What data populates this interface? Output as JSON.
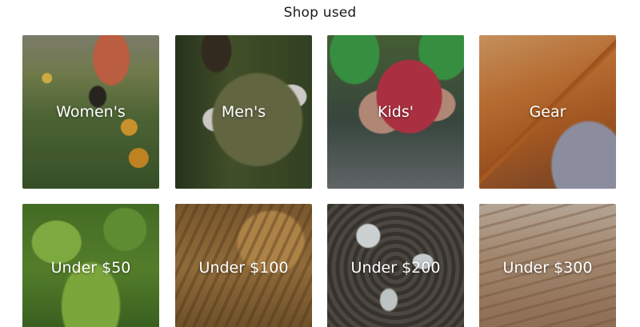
{
  "section": {
    "title": "Shop used"
  },
  "tiles": [
    {
      "label": "Women's"
    },
    {
      "label": "Men's"
    },
    {
      "label": "Kids'"
    },
    {
      "label": "Gear"
    },
    {
      "label": "Under $50"
    },
    {
      "label": "Under $100"
    },
    {
      "label": "Under $200"
    },
    {
      "label": "Under $300"
    }
  ]
}
